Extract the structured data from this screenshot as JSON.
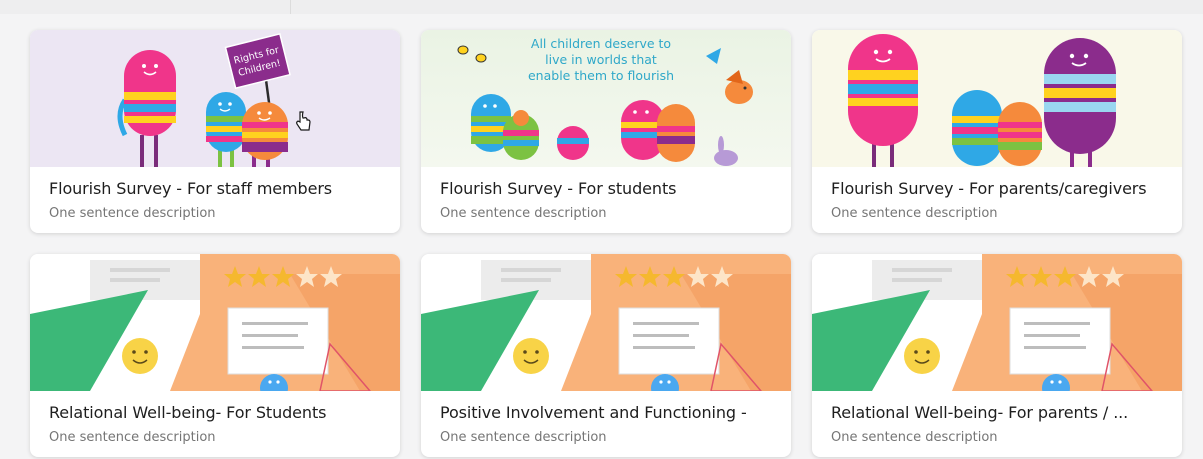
{
  "cards": [
    {
      "title": "Flourish Survey - For staff members",
      "description": "One sentence description",
      "illustration": "rainbow-characters-sign",
      "sign_text_1": "Rights for",
      "sign_text_2": "Children!"
    },
    {
      "title": "Flourish Survey - For students",
      "description": "One sentence description",
      "illustration": "rainbow-children-birds",
      "banner_line_1": "All children deserve to",
      "banner_line_2": "live in worlds that",
      "banner_line_3": "enable them to flourish"
    },
    {
      "title": "Flourish Survey - For parents/caregivers",
      "description": "One sentence description",
      "illustration": "rainbow-family"
    },
    {
      "title": "Relational Well-being- For Students",
      "description": "One sentence description",
      "illustration": "survey-stars-shapes"
    },
    {
      "title": "Positive Involvement and Functioning -",
      "description": "One sentence description",
      "illustration": "survey-stars-shapes"
    },
    {
      "title": "Relational Well-being- For parents / ...",
      "description": "One sentence description",
      "illustration": "survey-stars-shapes"
    }
  ],
  "colors": {
    "pink": "#f0358a",
    "yellow": "#ffd21f",
    "blue": "#2fa8e6",
    "green": "#7cc242",
    "orange": "#f58a3c",
    "purple": "#8b2c8c",
    "teal": "#3fb6c9",
    "survey_green": "#3cb878",
    "survey_orange": "#f9b27a",
    "star": "#f5b82e"
  },
  "cursor": "hand-pointer-icon"
}
